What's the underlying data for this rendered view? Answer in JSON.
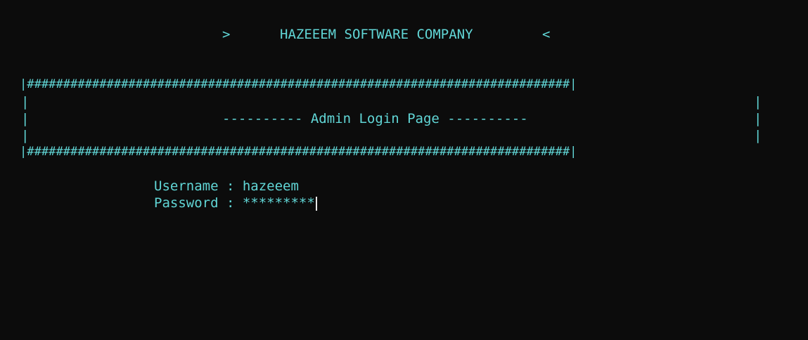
{
  "header": {
    "left_marker": ">",
    "company": "HAZEEEM SOFTWARE COMPANY",
    "right_marker": "<"
  },
  "banner": {
    "border_line": "|###########################################################################|",
    "side_left": "|",
    "side_right": "|",
    "title": "---------- Admin Login Page ----------"
  },
  "form": {
    "username_label": "Username : ",
    "username_value": "hazeeem",
    "password_label": "Password : ",
    "password_value": "*********"
  },
  "colors": {
    "background": "#0c0c0c",
    "text": "#61d6d6",
    "cursor": "#e6e6e6"
  }
}
